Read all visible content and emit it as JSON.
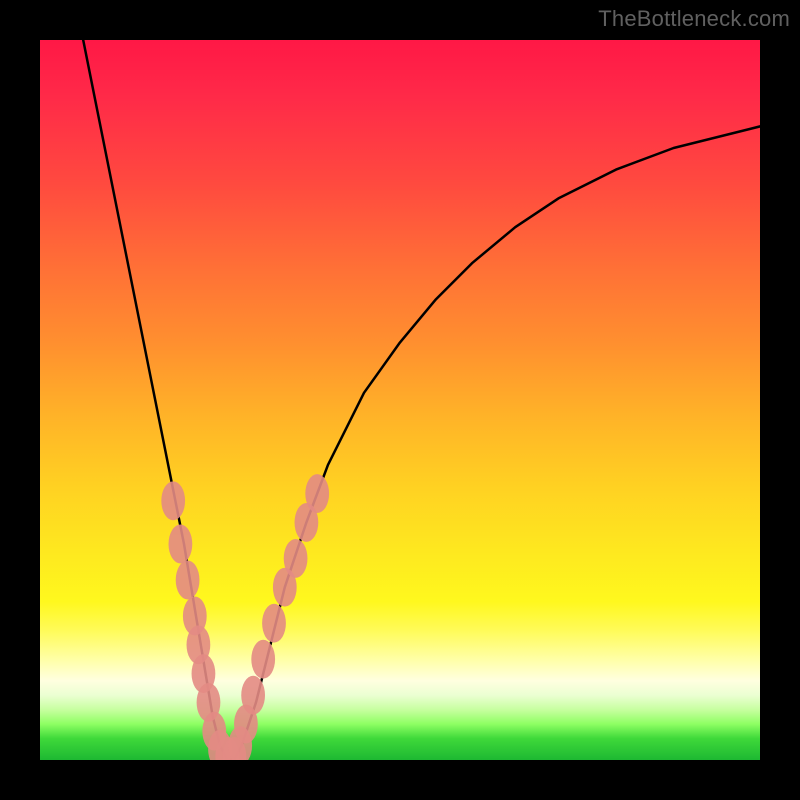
{
  "watermark": "TheBottleneck.com",
  "chart_data": {
    "type": "line",
    "title": "",
    "xlabel": "",
    "ylabel": "",
    "xlim": [
      0,
      100
    ],
    "ylim": [
      0,
      100
    ],
    "legend": false,
    "grid": false,
    "background_gradient": {
      "direction": "vertical",
      "stops": [
        {
          "pos": 0,
          "color": "#ff1846"
        },
        {
          "pos": 20,
          "color": "#ff4a3f"
        },
        {
          "pos": 42,
          "color": "#ff8f2f"
        },
        {
          "pos": 62,
          "color": "#ffd122"
        },
        {
          "pos": 82,
          "color": "#fffb59"
        },
        {
          "pos": 90,
          "color": "#ffffe0"
        },
        {
          "pos": 95,
          "color": "#8eff63"
        },
        {
          "pos": 100,
          "color": "#1db832"
        }
      ]
    },
    "series": [
      {
        "name": "bottleneck-curve",
        "color": "#000000",
        "x": [
          6,
          8,
          10,
          12,
          14,
          16,
          18,
          20,
          21,
          22,
          23,
          24,
          25,
          26,
          27,
          28,
          30,
          32,
          34,
          37,
          40,
          45,
          50,
          55,
          60,
          66,
          72,
          80,
          88,
          96,
          100
        ],
        "y": [
          100,
          90,
          80,
          70,
          60,
          50,
          40,
          30,
          24,
          18,
          12,
          6,
          2,
          0,
          0,
          2,
          8,
          16,
          24,
          33,
          41,
          51,
          58,
          64,
          69,
          74,
          78,
          82,
          85,
          87,
          88
        ]
      }
    ],
    "markers": [
      {
        "name": "highlight-dots",
        "color": "#e38b84",
        "radius": 3.0,
        "points": [
          {
            "x": 18.5,
            "y": 36
          },
          {
            "x": 19.5,
            "y": 30
          },
          {
            "x": 20.5,
            "y": 25
          },
          {
            "x": 21.5,
            "y": 20
          },
          {
            "x": 22.0,
            "y": 16
          },
          {
            "x": 22.7,
            "y": 12
          },
          {
            "x": 23.4,
            "y": 8
          },
          {
            "x": 24.2,
            "y": 4
          },
          {
            "x": 25.0,
            "y": 1.5
          },
          {
            "x": 26.0,
            "y": 0.5
          },
          {
            "x": 27.0,
            "y": 0.5
          },
          {
            "x": 27.8,
            "y": 2
          },
          {
            "x": 28.6,
            "y": 5
          },
          {
            "x": 29.6,
            "y": 9
          },
          {
            "x": 31.0,
            "y": 14
          },
          {
            "x": 32.5,
            "y": 19
          },
          {
            "x": 34.0,
            "y": 24
          },
          {
            "x": 35.5,
            "y": 28
          },
          {
            "x": 37.0,
            "y": 33
          },
          {
            "x": 38.5,
            "y": 37
          }
        ]
      }
    ]
  }
}
